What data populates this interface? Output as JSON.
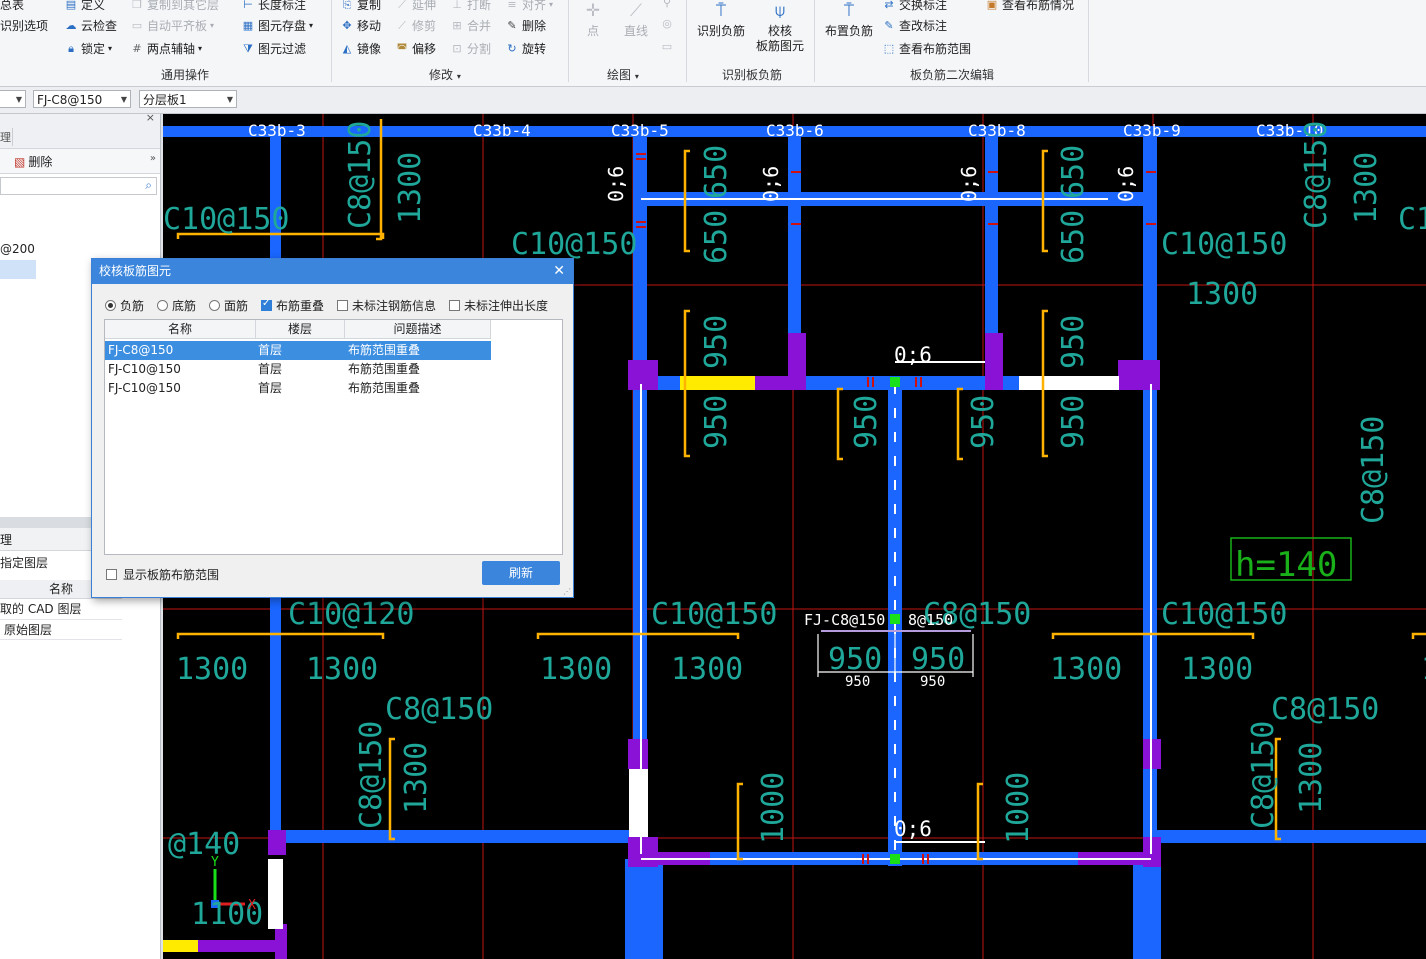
{
  "ribbon": {
    "col1": {
      "item_a": "总表",
      "item_b": "识别选项"
    },
    "col2": {
      "define": "定义",
      "cloud_check": "云检查",
      "lock": "锁定"
    },
    "col3": {
      "copy_layer": "复制到其它层",
      "auto_align": "自动平齐板",
      "two_point_axis": "两点辅轴"
    },
    "col4": {
      "length_mark": "长度标注",
      "save_element": "图元存盘",
      "filter_element": "图元过滤"
    },
    "col5": {
      "copy": "复制",
      "move": "移动",
      "mirror": "镜像"
    },
    "col6": {
      "extend": "延伸",
      "trim": "修剪",
      "offset": "偏移"
    },
    "col7": {
      "break": "打断",
      "merge": "合并",
      "split": "分割"
    },
    "col8": {
      "align": "对齐",
      "delete": "删除",
      "rotate": "旋转"
    },
    "draw": {
      "point": "点",
      "line": "直线"
    },
    "recognize": {
      "identify_neg": "识别负筋",
      "check_line1": "校核",
      "check_line2": "板筋图元"
    },
    "edit2": {
      "place_neg": "布置负筋",
      "swap_mark": "交换标注",
      "view_neg": "查看布筋情况",
      "edit_mark": "查改标注",
      "view_range": "查看布筋范围"
    },
    "groups": {
      "common_ops": "通用操作",
      "modify": "修改",
      "draw": "绘图",
      "recognize_slab_neg": "识别板负筋",
      "slab_neg_edit": "板负筋二次编辑"
    }
  },
  "selectors": {
    "rebar": "FJ-C8@150",
    "layer": "分层板1"
  },
  "left_panel": {
    "delete_label": "删除",
    "tree_item": "@200",
    "bottom_title": "理",
    "bottom_sub": "指定图层",
    "col_name": "名称",
    "rows": [
      "取的 CAD 图层",
      "原始图层"
    ]
  },
  "dialog": {
    "title": "校核板筋图元",
    "options": {
      "neg": "负筋",
      "bottom": "底筋",
      "face": "面筋",
      "overlap": "布筋重叠",
      "no_info": "未标注钢筋信息",
      "no_ext": "未标注伸出长度"
    },
    "columns": {
      "name": "名称",
      "floor": "楼层",
      "desc": "问题描述"
    },
    "rows": [
      {
        "name": "FJ-C8@150",
        "floor": "首层",
        "desc": "布筋范围重叠"
      },
      {
        "name": "FJ-C10@150",
        "floor": "首层",
        "desc": "布筋范围重叠"
      },
      {
        "name": "FJ-C10@150",
        "floor": "首层",
        "desc": "布筋范围重叠"
      }
    ],
    "show_range": "显示板筋布筋范围",
    "refresh": "刷新"
  },
  "canvas": {
    "top_labels": [
      "C33b-3",
      "C33b-4",
      "C33b-5",
      "C33b-6",
      "C33b-8",
      "C33b-9",
      "C33b-10"
    ],
    "bar_labels": {
      "c10_150": "C10@150",
      "c10_120": "C10@120",
      "c8_150": "C8@150",
      "at140": "@140",
      "n1300": "1300",
      "n950": "950",
      "n650": "650",
      "n1000": "1000",
      "n1100": "1100",
      "rebar_06": "0;6",
      "h140": "h=140",
      "fj_a": "FJ-C8@150",
      "fj_b": "8@150"
    },
    "dim_950": "950",
    "axis_x": "X",
    "axis_y": "Y",
    "colors": {
      "beam": "#1a66ff",
      "wall": "#8a11d6",
      "rebar": "#ffb300",
      "text": "#1fa79a",
      "red": "#d01010"
    }
  }
}
